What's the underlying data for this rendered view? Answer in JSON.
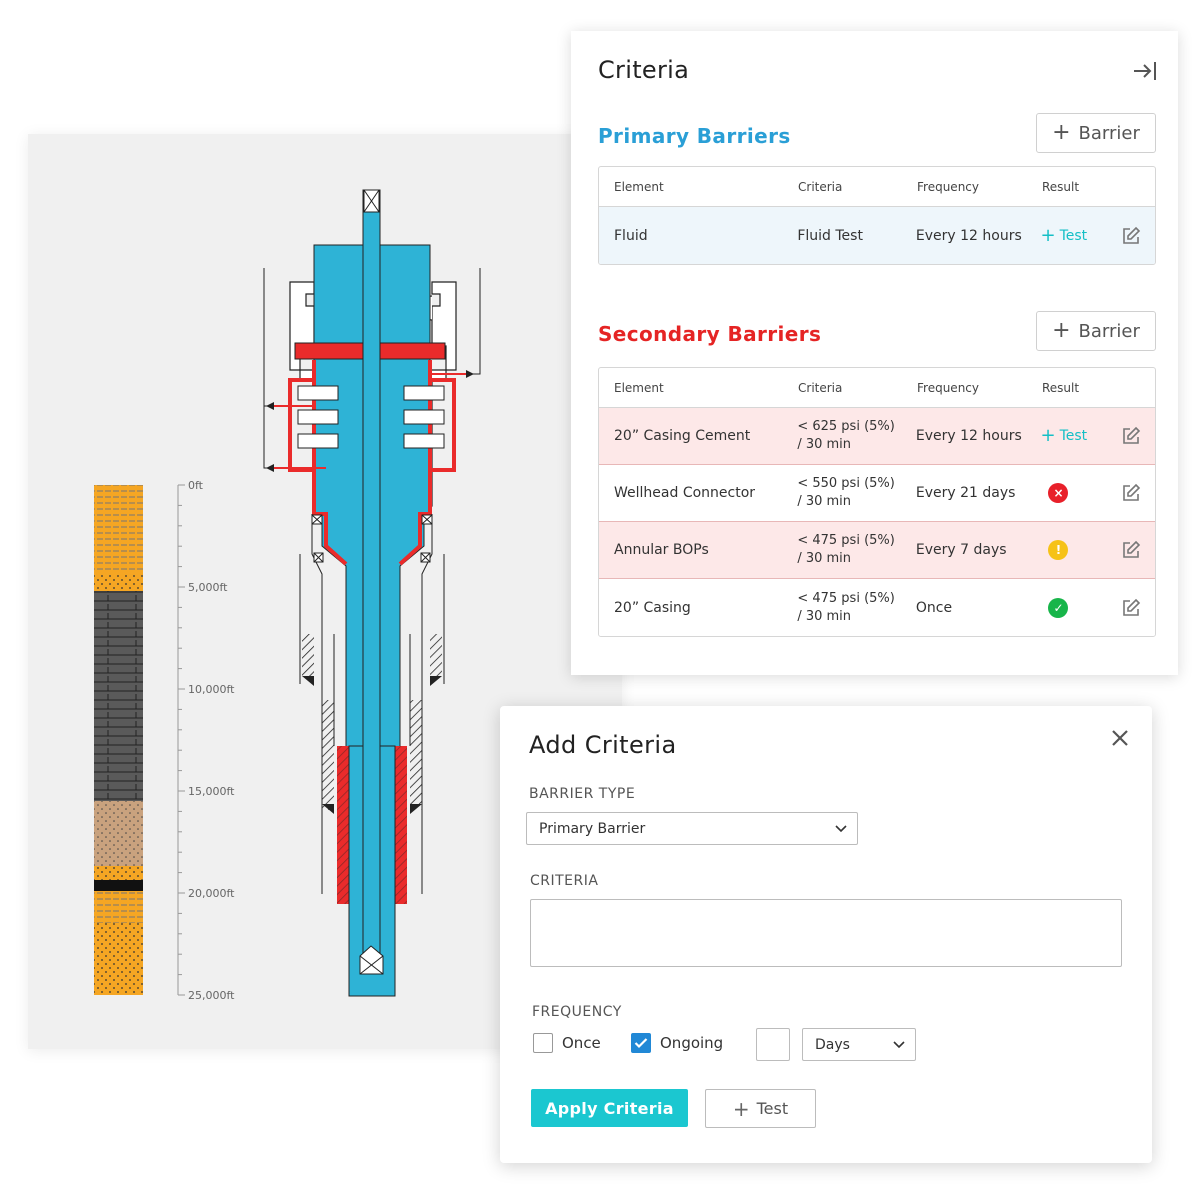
{
  "wellbore": {
    "depth_ticks": [
      "0ft",
      "5,000ft",
      "10,000ft",
      "15,000ft",
      "20,000ft",
      "25,000ft"
    ],
    "colors": {
      "tubing": "#2eb3d6",
      "seal": "#ea2b2b",
      "formation_sand": "#f5a623",
      "formation_shale": "#555555",
      "formation_tan": "#c9a27e"
    }
  },
  "criteria_panel": {
    "title": "Criteria",
    "collapse_icon": "collapse-right-icon",
    "primary": {
      "title": "Primary Barriers",
      "add_label": "Barrier",
      "headers": [
        "Element",
        "Criteria",
        "Frequency",
        "Result"
      ],
      "rows": [
        {
          "element": "Fluid",
          "criteria_line1": "Fluid Test",
          "criteria_line2": "",
          "frequency": "Every 12 hours",
          "result": "Test",
          "result_type": "test"
        }
      ]
    },
    "secondary": {
      "title": "Secondary Barriers",
      "add_label": "Barrier",
      "headers": [
        "Element",
        "Criteria",
        "Frequency",
        "Result"
      ],
      "rows": [
        {
          "element": "20” Casing Cement",
          "criteria_line1": "< 625 psi (5%)",
          "criteria_line2": "/ 30 min",
          "frequency": "Every 12 hours",
          "result": "Test",
          "result_type": "test"
        },
        {
          "element": "Wellhead Connector",
          "criteria_line1": "< 550 psi (5%)",
          "criteria_line2": "/ 30 min",
          "frequency": "Every 21 days",
          "result": "",
          "result_type": "fail"
        },
        {
          "element": "Annular BOPs",
          "criteria_line1": "< 475 psi (5%)",
          "criteria_line2": "/ 30 min",
          "frequency": "Every 7 days",
          "result": "",
          "result_type": "warn"
        },
        {
          "element": "20” Casing",
          "criteria_line1": "< 475 psi (5%)",
          "criteria_line2": "/ 30 min",
          "frequency": "Once",
          "result": "",
          "result_type": "pass"
        }
      ]
    }
  },
  "dialog": {
    "title": "Add Criteria",
    "barrier_type_label": "BARRIER TYPE",
    "barrier_type_value": "Primary Barrier",
    "criteria_label": "CRITERIA",
    "criteria_value": "",
    "frequency_label": "FREQUENCY",
    "once_label": "Once",
    "once_checked": false,
    "ongoing_label": "Ongoing",
    "ongoing_checked": true,
    "interval_value": "",
    "unit_value": "Days",
    "apply_label": "Apply Criteria",
    "test_label": "Test"
  }
}
